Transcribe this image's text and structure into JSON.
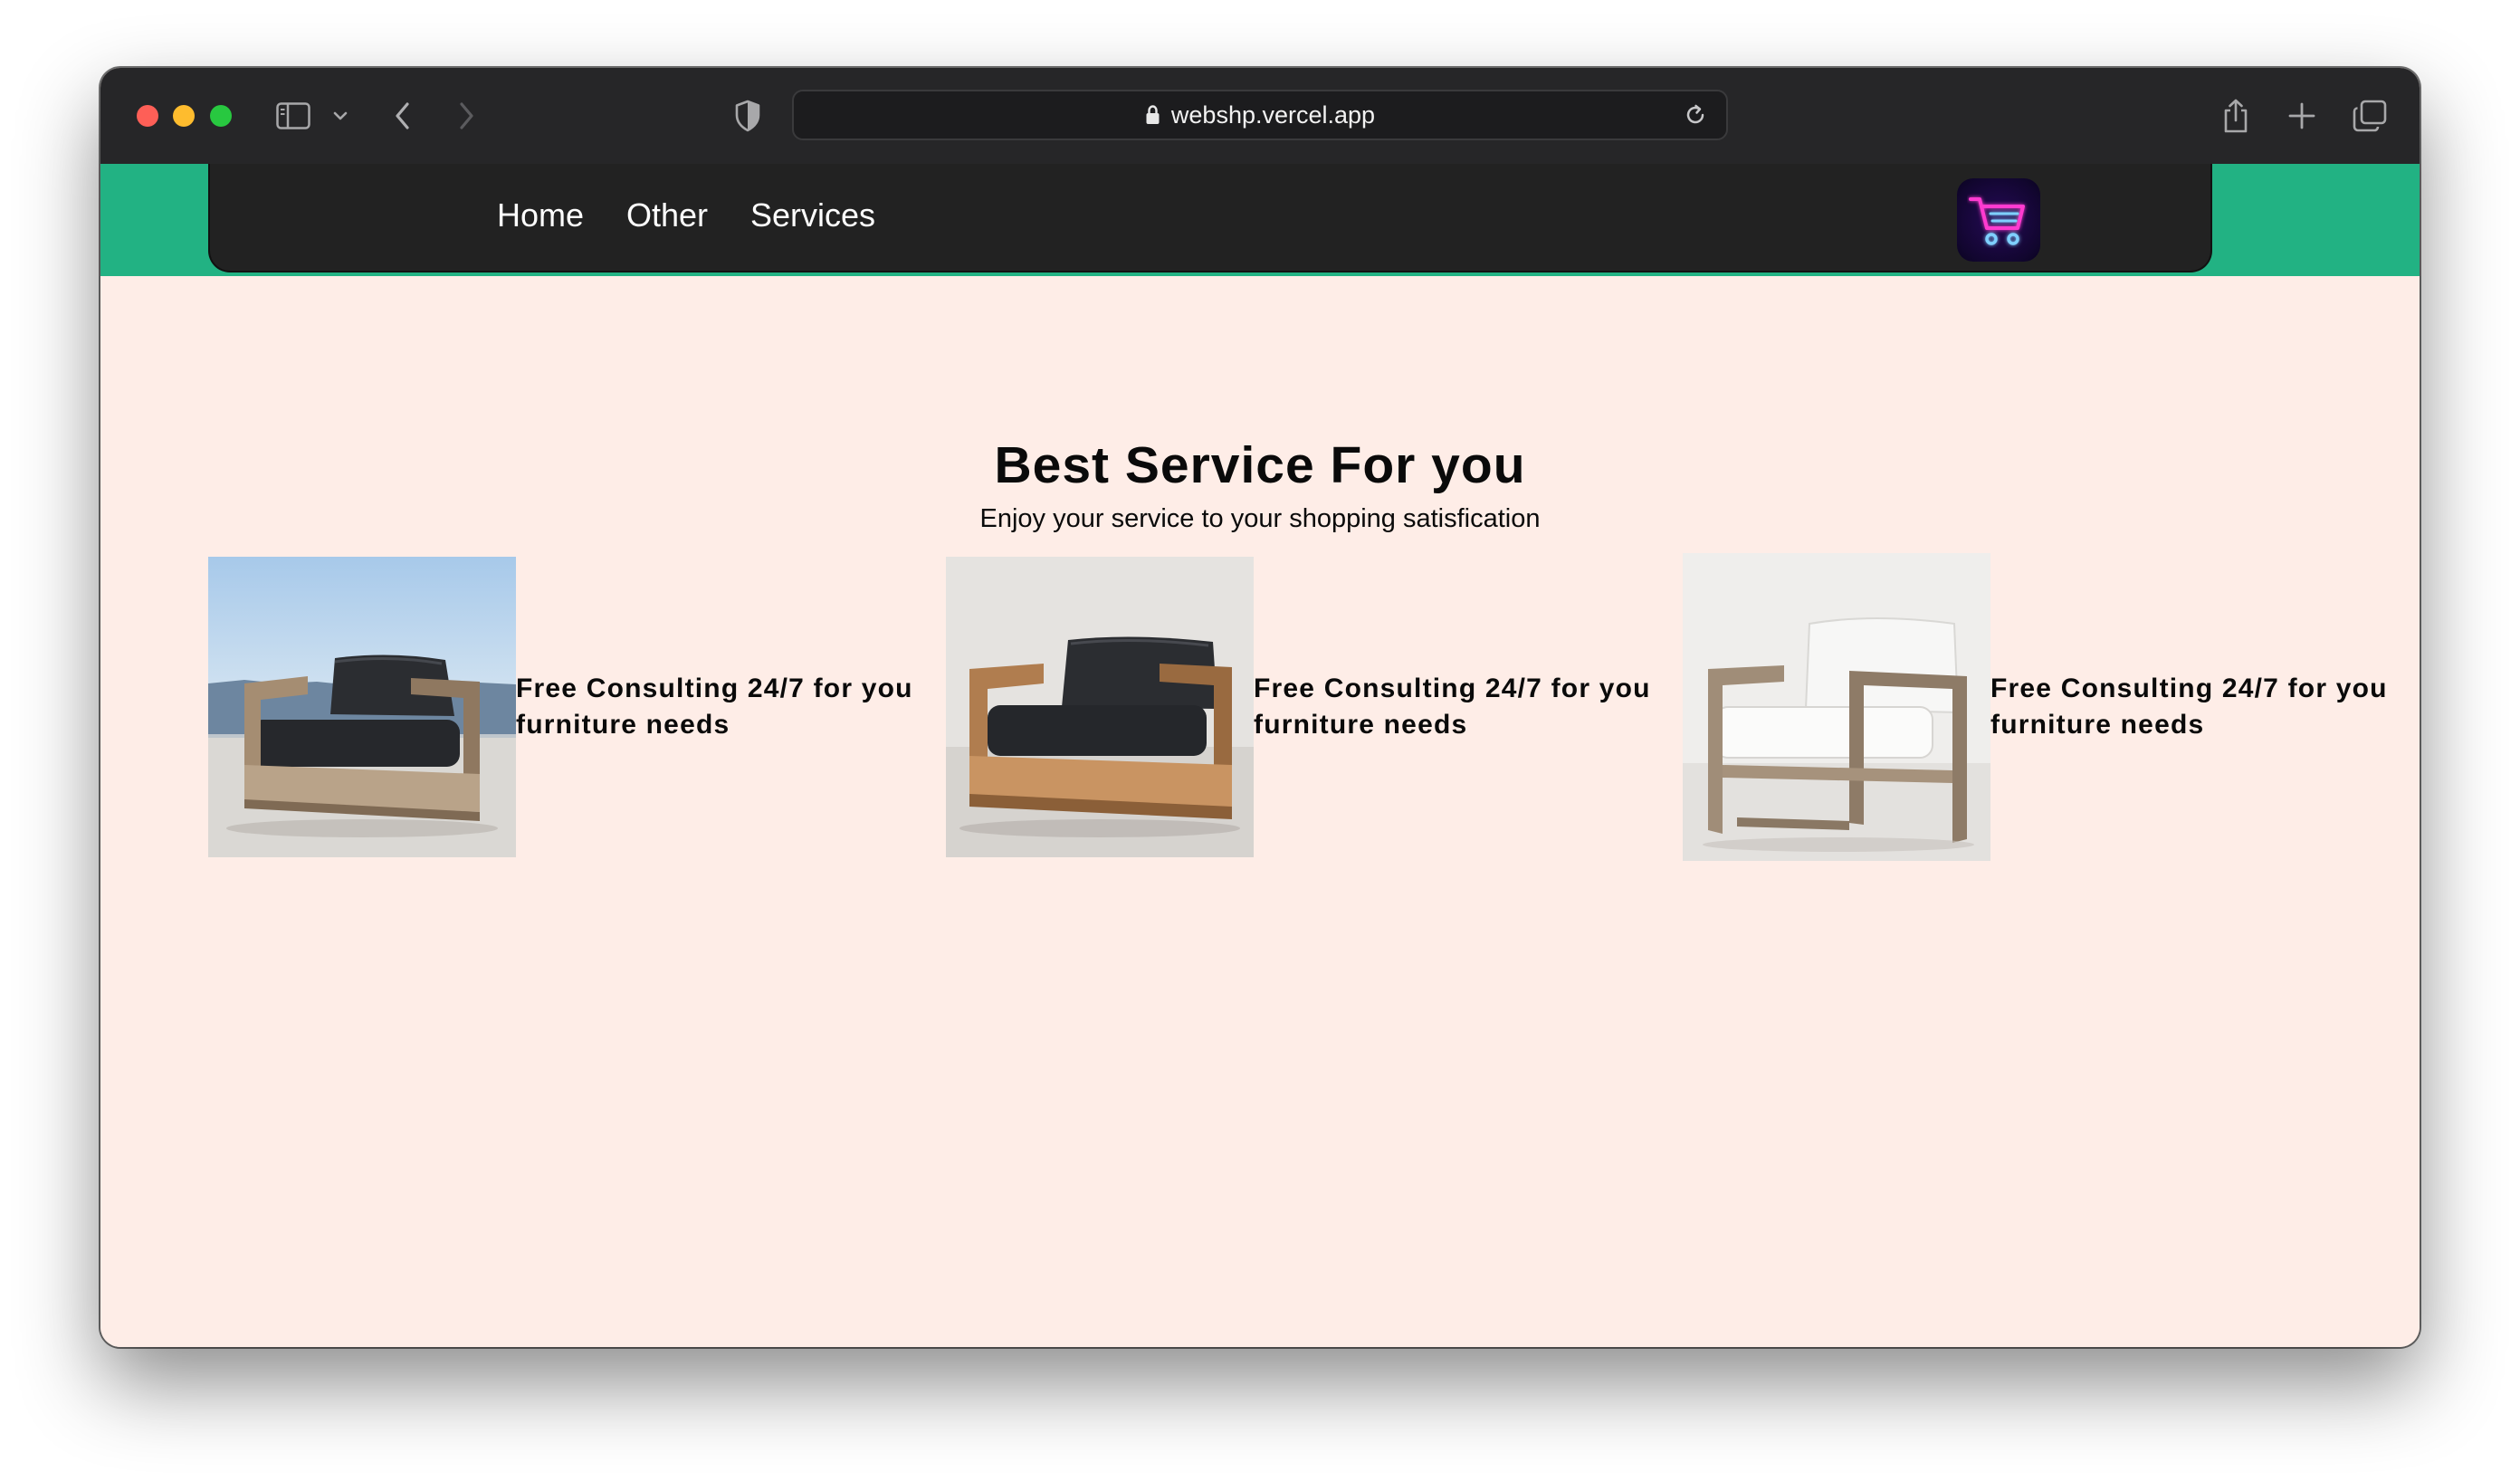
{
  "browser": {
    "url": "webshp.vercel.app"
  },
  "nav": {
    "links": [
      "Home",
      "Other",
      "Services"
    ]
  },
  "hero": {
    "title": "Best Service For you",
    "subtitle": "Enjoy your service to your shopping satisfication"
  },
  "services": [
    {
      "text": "Free Consulting 24/7 for you furniture needs"
    },
    {
      "text": "Free Consulting 24/7 for you furniture needs"
    },
    {
      "text": "Free Consulting 24/7 for you furniture needs"
    }
  ],
  "colors": {
    "page_background": "#feede7",
    "nav_strip": "#22b283",
    "nav_bar": "#222222",
    "browser_chrome": "#262628",
    "cart_glow": "#ff3bd0"
  },
  "icons": {
    "toolbar": [
      "sidebar-icon",
      "chevron-down-icon",
      "back-icon",
      "forward-icon",
      "privacy-shield-icon",
      "lock-icon",
      "reload-icon",
      "share-icon",
      "new-tab-icon",
      "tab-overview-icon"
    ],
    "cart": "shopping-cart-icon"
  }
}
